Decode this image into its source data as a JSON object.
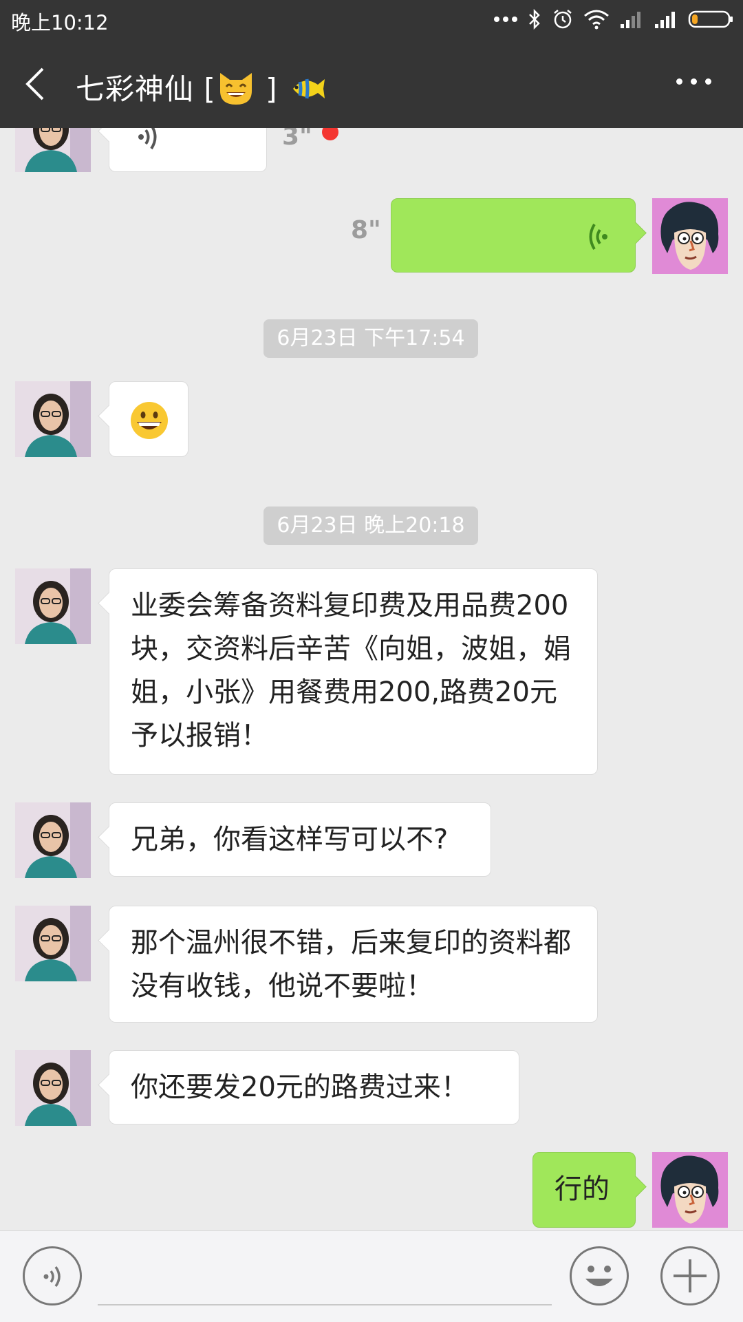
{
  "status_bar": {
    "time": "晚上10:12"
  },
  "header": {
    "title_prefix": "七彩神仙 [",
    "title_suffix": " ]",
    "emoji_cat": "grinning-cat-icon",
    "emoji_fish": "tropical-fish-icon"
  },
  "messages": {
    "voice_incoming_duration": "3\"",
    "voice_outgoing_duration": "8\"",
    "time_1": "6月23日 下午17:54",
    "emoji_message": "grinning-face-icon",
    "time_2": "6月23日 晚上20:18",
    "msg_1": "业委会筹备资料复印费及用品费200块，交资料后辛苦《向姐，波姐，娟姐，小张》用餐费用200,路费20元予以报销！",
    "msg_2": "兄弟，你看这样写可以不?",
    "msg_3": "那个温州很不错，后来复印的资料都没有收钱，他说不要啦！",
    "msg_4": "你还要发20元的路费过来！",
    "msg_5": "行的"
  },
  "colors": {
    "header_bg": "#353535",
    "chat_bg": "#ebebeb",
    "outgoing_bubble": "#a0e75a",
    "unread_dot": "#f43530"
  }
}
